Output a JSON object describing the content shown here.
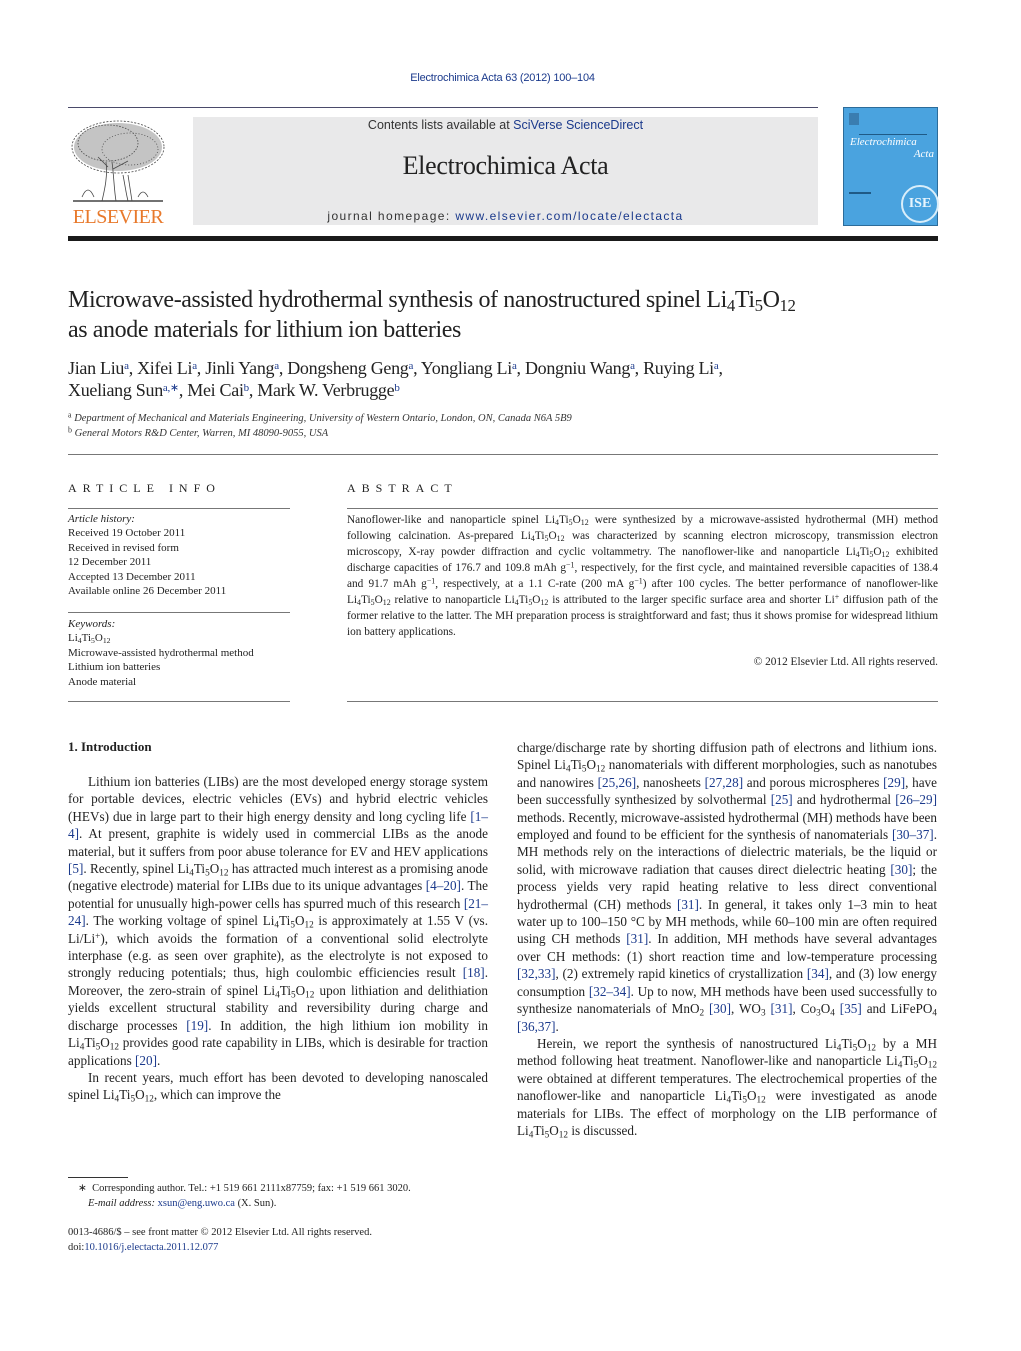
{
  "header": {
    "journal_ref": "Electrochimica Acta 63 (2012) 100–104",
    "contents_prefix": "Contents lists available at ",
    "contents_link": "SciVerse ScienceDirect",
    "journal_title": "Electrochimica Acta",
    "homepage_prefix": "journal homepage: ",
    "homepage_link": "www.elsevier.com/locate/electacta",
    "publisher_logo": "ELSEVIER",
    "cover": {
      "title_line1": "Electrochimica",
      "title_line2": "Acta",
      "badge": "ISE",
      "color": "#4aa3df"
    }
  },
  "article": {
    "title_part1": "Microwave-assisted hydrothermal synthesis of nanostructured spinel Li",
    "title_part2": "as anode materials for lithium ion batteries",
    "authors": [
      {
        "name": "Jian Liu",
        "aff": "a",
        "sep": ", "
      },
      {
        "name": "Xifei Li",
        "aff": "a",
        "sep": ", "
      },
      {
        "name": "Jinli Yang",
        "aff": "a",
        "sep": ", "
      },
      {
        "name": "Dongsheng Geng",
        "aff": "a",
        "sep": ", "
      },
      {
        "name": "Yongliang Li",
        "aff": "a",
        "sep": ", "
      },
      {
        "name": "Dongniu Wang",
        "aff": "a",
        "sep": ", "
      },
      {
        "name": "Ruying Li",
        "aff": "a",
        "sep": ","
      },
      {
        "name": "Xueliang Sun",
        "aff": "a,∗",
        "sep": ", "
      },
      {
        "name": "Mei Cai",
        "aff": "b",
        "sep": ", "
      },
      {
        "name": "Mark W. Verbrugge",
        "aff": "b",
        "sep": ""
      }
    ],
    "affiliations": [
      {
        "key": "a",
        "text": "Department of Mechanical and Materials Engineering, University of Western Ontario, London, ON, Canada N6A 5B9"
      },
      {
        "key": "b",
        "text": "General Motors R&D Center, Warren, MI 48090-9055, USA"
      }
    ]
  },
  "article_info": {
    "heading": "ARTICLE INFO",
    "history_label": "Article history:",
    "history": [
      "Received 19 October 2011",
      "Received in revised form",
      "12 December 2011",
      "Accepted 13 December 2011",
      "Available online 26 December 2011"
    ],
    "keywords_label": "Keywords:",
    "keywords": [
      "Microwave-assisted hydrothermal method",
      "Lithium ion batteries",
      "Anode material"
    ]
  },
  "abstract": {
    "heading": "ABSTRACT",
    "s1": "Nanoflower-like and nanoparticle spinel ",
    "s2": " were synthesized by a microwave-assisted hydrothermal (MH) method following calcination. As-prepared ",
    "s3": " was characterized by scanning electron microscopy, transmission electron microscopy, X-ray powder diffraction and cyclic voltammetry. The nanoflower-like and nanoparticle ",
    "s4": " exhibited discharge capacities of 176.7 and 109.8 mAh g",
    "s5": ", respectively, for the first cycle, and maintained reversible capacities of 138.4 and 91.7 mAh g",
    "s6": ", respectively, at a 1.1 C-rate (200 mA g",
    "s7": ") after 100 cycles. The better performance of nanoflower-like ",
    "s8": " relative to nanoparticle ",
    "s9": " is attributed to the larger specific surface area and shorter Li",
    "s10": " diffusion path of the former relative to the latter. The MH preparation process is straightforward and fast; thus it shows promise for widespread lithium ion battery applications.",
    "copyright": "© 2012 Elsevier Ltd. All rights reserved."
  },
  "introduction": {
    "heading": "1.  Introduction",
    "left": {
      "p1a": "Lithium ion batteries (LIBs) are the most developed energy storage system for portable devices, electric vehicles (EVs) and hybrid electric vehicles (HEVs) due in large part to their high energy density and long cycling life ",
      "r1": "[1–4]",
      "p1b": ". At present, graphite is widely used in commercial LIBs as the anode material, but it suffers from poor abuse tolerance for EV and HEV applications ",
      "r2": "[5]",
      "p1c": ". Recently, spinel ",
      "p1d": " has attracted much interest as a promising anode (negative electrode) material for LIBs due to its unique advantages ",
      "r3": "[4–20]",
      "p1e": ". The potential for unusually high-power cells has spurred much of this research ",
      "r4": "[21–24]",
      "p1f": ". The working voltage of spinel ",
      "p1g": " is approximately at 1.55 V (vs. Li/Li",
      "p1h": "), which avoids the formation of a conventional solid electrolyte interphase (e.g. as seen over graphite), as the electrolyte is not exposed to strongly reducing potentials; thus, high coulombic efficiencies result ",
      "r5": "[18]",
      "p1i": ". Moreover, the zero-strain of spinel ",
      "p1j": " upon lithiation and delithiation yields excellent structural stability and reversibility during charge and discharge processes ",
      "r6": "[19]",
      "p1k": ". In addition, the high lithium ion mobility in ",
      "p1l": " provides good rate capability in LIBs, which is desirable for traction applications ",
      "r7": "[20]",
      "p1m": ".",
      "p2a": "In recent years, much effort has been devoted to developing nanoscaled spinel ",
      "p2b": ", which can improve the"
    },
    "right": {
      "p1a": "charge/discharge rate by shorting diffusion path of electrons and lithium ions. Spinel ",
      "p1b": " nanomaterials with different morphologies, such as nanotubes and nanowires ",
      "r1": "[25,26]",
      "p1c": ", nanosheets ",
      "r2": "[27,28]",
      "p1d": " and porous microspheres ",
      "r3": "[29]",
      "p1e": ", have been successfully synthesized by solvothermal ",
      "r4": "[25]",
      "p1f": " and hydrothermal ",
      "r5": "[26–29]",
      "p1g": " methods. Recently, microwave-assisted hydrothermal (MH) methods have been employed and found to be efficient for the synthesis of nanomaterials ",
      "r6": "[30–37]",
      "p1h": ". MH methods rely on the interactions of dielectric materials, be the liquid or solid, with microwave radiation that causes direct dielectric heating ",
      "r7": "[30]",
      "p1i": "; the process yields very rapid heating relative to less direct conventional hydrothermal (CH) methods ",
      "r8": "[31]",
      "p1j": ". In general, it takes only 1–3 min to heat water up to 100–150 °C by MH methods, while 60–100 min are often required using CH methods ",
      "r9": "[31]",
      "p1k": ". In addition, MH methods have several advantages over CH methods: (1) short reaction time and low-temperature processing ",
      "r10": "[32,33]",
      "p1l": ", (2) extremely rapid kinetics of crystallization ",
      "r11": "[34]",
      "p1m": ", and (3) low energy consumption ",
      "r12": "[32–34]",
      "p1n": ". Up to now, MH methods have been used successfully to synthesize nanomaterials of MnO",
      "r13": "[30]",
      "p1o": ", WO",
      "r14": "[31]",
      "p1p": ", Co",
      "r15": "[35]",
      "p1q": " and LiFePO",
      "r16": "[36,37]",
      "p1r": ".",
      "p2a": "Herein, we report the synthesis of nanostructured ",
      "p2b": " by a MH method following heat treatment. Nanoflower-like and nanoparticle ",
      "p2c": " were obtained at different temperatures. The electrochemical properties of the nanoflower-like and nanoparticle ",
      "p2d": " were investigated as anode materials for LIBs. The effect of morphology on the LIB performance of ",
      "p2e": " is discussed."
    }
  },
  "footnote": {
    "star": "∗",
    "corresponding": "Corresponding author. Tel.: +1 519 661 2111x87759; fax: +1 519 661 3020.",
    "email_label": "E-mail address: ",
    "email": "xsun@eng.uwo.ca",
    "email_suffix": " (X. Sun)."
  },
  "issn": {
    "line1": "0013-4686/$ – see front matter © 2012 Elsevier Ltd. All rights reserved.",
    "doi_prefix": "doi:",
    "doi": "10.1016/j.electacta.2011.12.077"
  },
  "formula": {
    "li": "Li",
    "li_n": "4",
    "ti": "Ti",
    "ti_n": "5",
    "o": "O",
    "o_n": "12"
  },
  "colors": {
    "link": "#1b3a8c",
    "elsevier_orange": "#e8792b",
    "masthead_bg": "#e9e9ea"
  }
}
